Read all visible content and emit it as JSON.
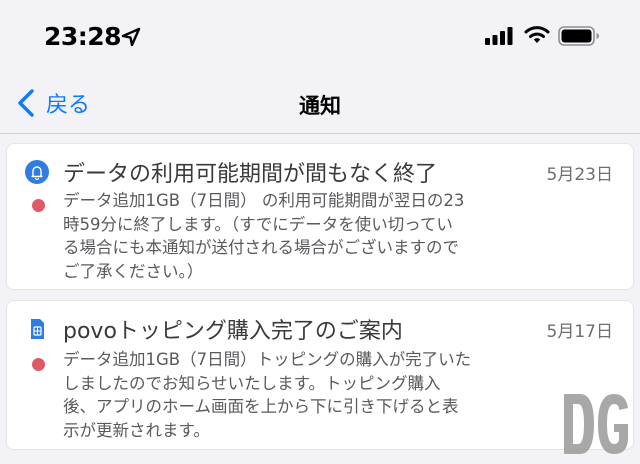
{
  "status_bar": {
    "time": "23:28",
    "icons": [
      "location-arrow-icon",
      "signal-icon",
      "wifi-icon",
      "battery-icon"
    ]
  },
  "nav": {
    "back_label": "戻る",
    "title": "通知"
  },
  "notifications": [
    {
      "icon": "bell-icon",
      "title": "データの利用可能期間が間もなく終了",
      "date": "5月23日",
      "body": "データ追加1GB（7日間） の利用可能期間が翌日の23\n時59分に終了します。（すでにデータを使い切ってい\nる場合にも本通知が送付される場合がございますので\nご了承ください。）",
      "unread": true
    },
    {
      "icon": "sim-card-icon",
      "title": "povoトッピング購入完了のご案内",
      "date": "5月17日",
      "body": "データ追加1GB（7日間）トッピングの購入が完了いた\nしましたのでお知らせいたします。トッピング購入\n後、アプリのホーム画面を上から下に引き下げると表\n示が更新されます。",
      "unread": true
    }
  ],
  "colors": {
    "accent": "#0a7aff",
    "unread_dot": "#e05a66",
    "background": "#f2f2f7"
  },
  "watermark": {
    "text": "DG"
  }
}
